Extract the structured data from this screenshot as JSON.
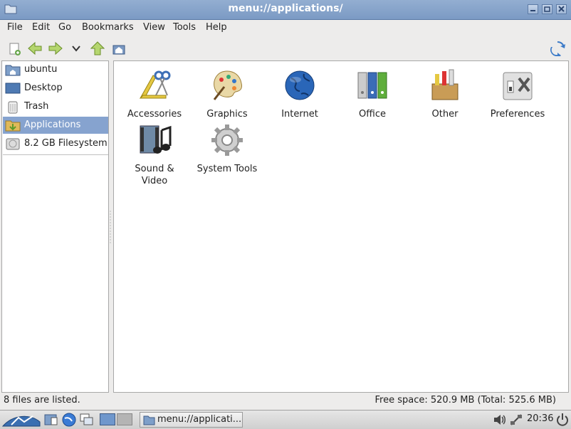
{
  "window": {
    "title": "menu://applications/"
  },
  "menu": [
    {
      "label": "File"
    },
    {
      "label": "Edit"
    },
    {
      "label": "Go"
    },
    {
      "label": "Bookmarks"
    },
    {
      "label": "View"
    },
    {
      "label": "Tools"
    },
    {
      "label": "Help"
    }
  ],
  "toolbar": {
    "location_value": "menu://applications/",
    "icons": [
      "new-tab-icon",
      "back-arrow-icon",
      "forward-arrow-icon",
      "history-dropdown-icon",
      "up-arrow-icon",
      "home-icon",
      "go-refresh-icon"
    ]
  },
  "sidebar": {
    "items": [
      {
        "label": "ubuntu",
        "icon": "home-folder-icon"
      },
      {
        "label": "Desktop",
        "icon": "desktop-icon"
      },
      {
        "label": "Trash",
        "icon": "trash-icon"
      },
      {
        "label": "Applications",
        "icon": "applications-folder-icon",
        "selected": true
      },
      {
        "label": "8.2 GB Filesystem",
        "icon": "drive-icon"
      }
    ]
  },
  "files": [
    {
      "label": "Accessories",
      "icon": "accessories-icon"
    },
    {
      "label": "Graphics",
      "icon": "graphics-palette-icon"
    },
    {
      "label": "Internet",
      "icon": "globe-icon"
    },
    {
      "label": "Office",
      "icon": "office-binders-icon"
    },
    {
      "label": "Other",
      "icon": "other-box-icon"
    },
    {
      "label": "Preferences",
      "icon": "preferences-tools-icon"
    },
    {
      "label": "Sound & Video",
      "icon": "sound-video-icon"
    },
    {
      "label": "System Tools",
      "icon": "system-gear-icon"
    }
  ],
  "status": {
    "left": "8 files are listed.",
    "right": "Free space: 520.9 MB (Total: 525.6 MB)"
  },
  "taskbar": {
    "task_label": "menu://applicati...",
    "clock": "20:36"
  },
  "colors": {
    "titlebar": "#7b9ac4",
    "selection": "#86a3cf",
    "background": "#edeceb"
  }
}
